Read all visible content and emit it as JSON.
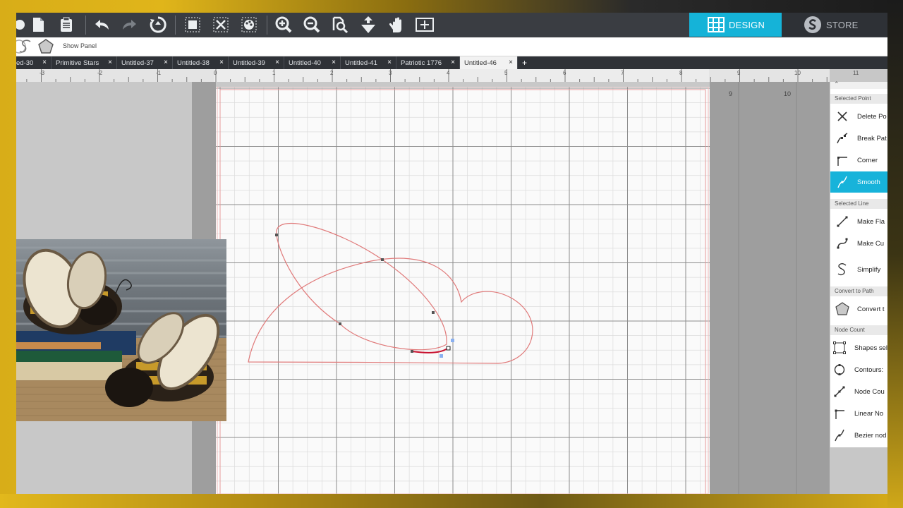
{
  "toolbar": {
    "icons": [
      "shape-icon",
      "new-file-icon",
      "clipboard-icon",
      "undo-icon",
      "redo-icon",
      "rotate-icon",
      "group-icon",
      "ungroup-icon",
      "color-palette-icon",
      "zoom-in-icon",
      "zoom-out-icon",
      "zoom-select-icon",
      "move-down-icon",
      "pan-hand-icon",
      "fit-page-icon"
    ]
  },
  "modes": {
    "design": "DESIGN",
    "store": "STORE"
  },
  "subbar": {
    "show_panel": "Show Panel"
  },
  "tabs": [
    {
      "label": "ed-30"
    },
    {
      "label": "Primitive Stars"
    },
    {
      "label": "Untitled-37"
    },
    {
      "label": "Untitled-38"
    },
    {
      "label": "Untitled-39"
    },
    {
      "label": "Untitled-40"
    },
    {
      "label": "Untitled-41"
    },
    {
      "label": "Patriotic 1776"
    },
    {
      "label": "Untitled-46"
    }
  ],
  "tab_add": "+",
  "ruler_numbers": [
    "-3",
    "-2",
    "-1",
    "0",
    "1",
    "2",
    "3",
    "4",
    "5",
    "6",
    "7",
    "8",
    "9",
    "10",
    "11"
  ],
  "canvas_numbers": [
    "9",
    "10"
  ],
  "panel": {
    "sections": [
      {
        "title": "Selected Point",
        "items": [
          "Delete Po",
          "Break Pat",
          "Corner",
          "Smooth"
        ]
      },
      {
        "title": "Selected Line",
        "items": [
          "Make Fla",
          "Make Cu",
          "Simplify"
        ]
      },
      {
        "title": "Convert to Path",
        "items": [
          "Convert t"
        ]
      },
      {
        "title": "Node Count",
        "items": [
          "Shapes sel",
          "Contours:",
          "Node Cou",
          "Linear No",
          "Bezier nod"
        ]
      }
    ],
    "active_item": "Smooth"
  },
  "colors": {
    "accent": "#15b3d8",
    "cut_line": "#e07a7a",
    "selected_segment": "#c8102e"
  }
}
